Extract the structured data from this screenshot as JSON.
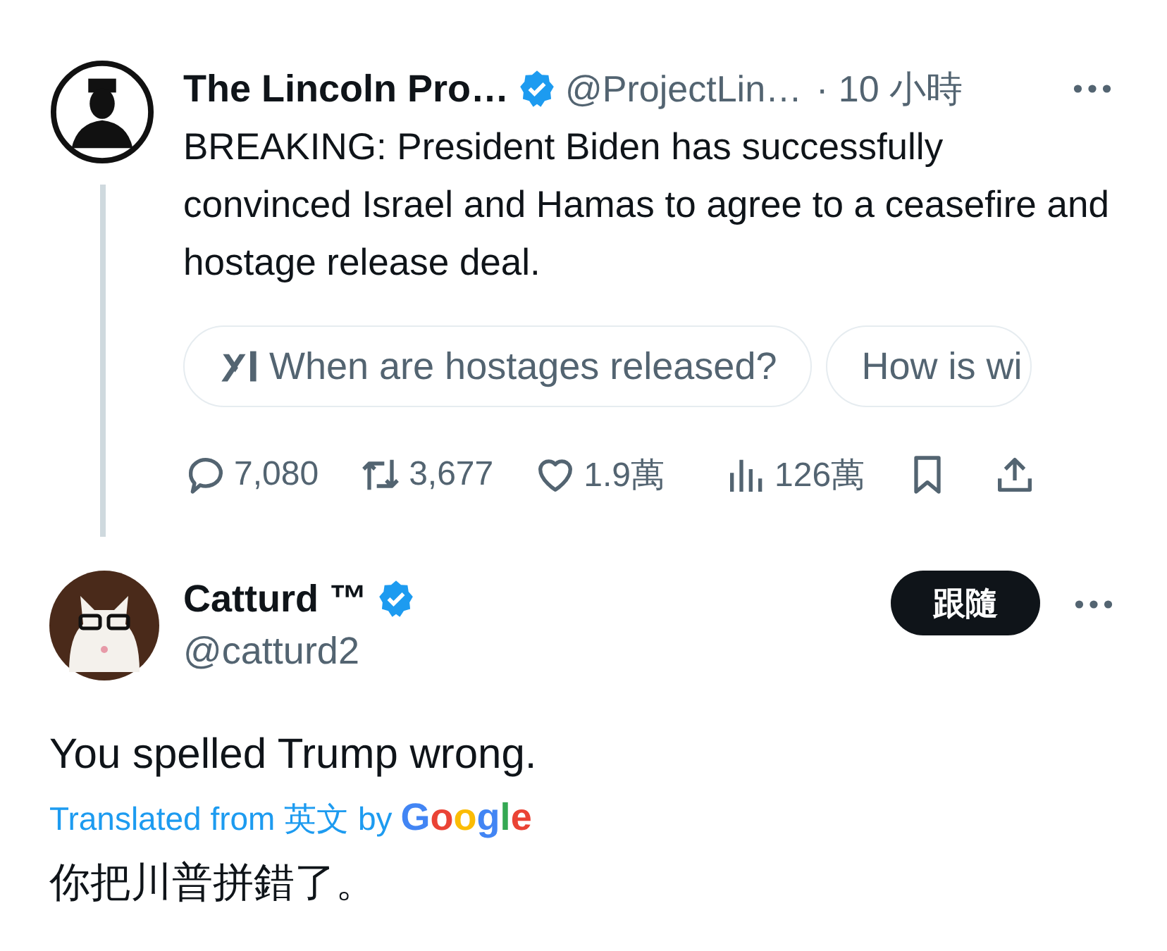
{
  "parent_tweet": {
    "name": "The Lincoln Pro…",
    "verified": true,
    "handle": "@ProjectLin…",
    "time": "· 10 小時",
    "text": "BREAKING: President Biden has successfully convinced Israel and Hamas to agree to a ceasefire and hostage release deal.",
    "grok_chips": [
      "When are hostages released?",
      "How is wi"
    ],
    "actions": [
      {
        "kind": "reply",
        "count": "7,080"
      },
      {
        "kind": "repost",
        "count": "3,677"
      },
      {
        "kind": "like",
        "count": "1.9萬"
      },
      {
        "kind": "views",
        "count": "126萬"
      },
      {
        "kind": "bookmark"
      },
      {
        "kind": "share"
      }
    ]
  },
  "reply_tweet": {
    "name": "Catturd ™",
    "verified": true,
    "handle": "@catturd2",
    "follow_button": "跟隨",
    "text": "You spelled Trump wrong.",
    "translation": {
      "label": "Translated from 英文 by",
      "logo": "Google"
    },
    "translated_text": "你把川普拼錯了。"
  }
}
